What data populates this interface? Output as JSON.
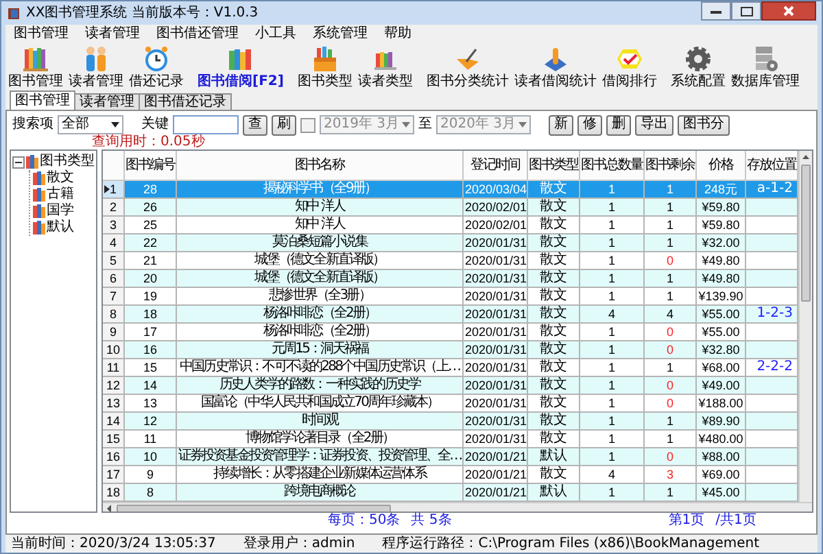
{
  "window": {
    "title": "XX图书管理系统  当前版本号：V1.0.3"
  },
  "menu": [
    "图书管理",
    "读者管理",
    "图书借还管理",
    "小工具",
    "系统管理",
    "帮助"
  ],
  "toolbar": [
    {
      "label": "图书管理",
      "emphasized": false
    },
    {
      "label": "读者管理",
      "emphasized": false
    },
    {
      "label": "借还记录",
      "emphasized": false
    },
    {
      "label": "图书借阅[F2]",
      "emphasized": true
    },
    {
      "label": "图书类型",
      "emphasized": false
    },
    {
      "label": "读者类型",
      "emphasized": false
    },
    {
      "label": "图书分类统计",
      "emphasized": false
    },
    {
      "label": "读者借阅统计",
      "emphasized": false
    },
    {
      "label": "借阅排行",
      "emphasized": false
    },
    {
      "label": "系统配置",
      "emphasized": false
    },
    {
      "label": "数据库管理",
      "emphasized": false
    }
  ],
  "tabs": [
    {
      "label": "图书管理",
      "selected": true
    },
    {
      "label": "读者管理",
      "selected": false
    },
    {
      "label": "图书借还记录",
      "selected": false
    }
  ],
  "search": {
    "field_label": "搜索项",
    "field": "全部",
    "keyword_label": "关键",
    "query_button": "查",
    "refresh_button": "刷",
    "date_filter": {
      "checked": false,
      "from": "2019年 3月",
      "to_label": "至",
      "to": "2020年 3月"
    },
    "actions": [
      "新",
      "修",
      "删",
      "导出",
      "图书分"
    ],
    "elapsed": "查询用时：0.05秒"
  },
  "tree": {
    "label": "图书类型",
    "expanded": true,
    "children": [
      {
        "label": "散文"
      },
      {
        "label": "古籍"
      },
      {
        "label": "国学"
      },
      {
        "label": "默认"
      }
    ]
  },
  "table": {
    "columns": [
      "图书编号",
      "图书名称",
      "登记时间",
      "图书类型",
      "图书总数量",
      "图书剩余",
      "价格",
      "存放位置"
    ],
    "rows": [
      {
        "index": "1",
        "id": "28",
        "name": "揭秘科学书（全9册）",
        "date": "2020/03/04",
        "type": "散文",
        "total": "1",
        "remaining": "1",
        "price": "248元",
        "location": "a-1-2",
        "selected": true,
        "low_stock": false
      },
      {
        "index": "2",
        "id": "26",
        "name": "知中 洋人",
        "date": "2020/02/01",
        "type": "散文",
        "total": "1",
        "remaining": "1",
        "price": "¥59.80",
        "selected": false,
        "low_stock": false
      },
      {
        "index": "3",
        "id": "25",
        "name": "知中 洋人",
        "date": "2020/02/01",
        "type": "散文",
        "total": "1",
        "remaining": "1",
        "price": "¥59.80",
        "selected": false,
        "low_stock": false
      },
      {
        "index": "4",
        "id": "22",
        "name": "莫泊桑短篇小说集",
        "date": "2020/01/31",
        "type": "散文",
        "total": "1",
        "remaining": "1",
        "price": "¥32.00",
        "selected": false,
        "low_stock": false
      },
      {
        "index": "5",
        "id": "21",
        "name": "城堡（德文全新直译版）",
        "date": "2020/01/31",
        "type": "散文",
        "total": "1",
        "remaining": "0",
        "price": "¥49.80",
        "selected": false,
        "low_stock": true
      },
      {
        "index": "6",
        "id": "20",
        "name": "城堡（德文全新直译版）",
        "date": "2020/01/31",
        "type": "散文",
        "total": "1",
        "remaining": "1",
        "price": "¥49.80",
        "selected": false,
        "low_stock": false
      },
      {
        "index": "7",
        "id": "19",
        "name": "悲惨世界（全3册）",
        "date": "2020/01/31",
        "type": "散文",
        "total": "1",
        "remaining": "1",
        "price": "¥139.90",
        "selected": false,
        "low_stock": false
      },
      {
        "index": "8",
        "id": "18",
        "name": "杨洛咔啡恋（全2册）",
        "date": "2020/01/31",
        "type": "散文",
        "total": "4",
        "remaining": "4",
        "price": "¥55.00",
        "location": "1-2-3",
        "selected": false,
        "low_stock": false
      },
      {
        "index": "9",
        "id": "17",
        "name": "杨洛咔啡恋（全2册）",
        "date": "2020/01/31",
        "type": "散文",
        "total": "1",
        "remaining": "0",
        "price": "¥55.00",
        "selected": false,
        "low_stock": true
      },
      {
        "index": "10",
        "id": "16",
        "name": "元周15：洞天祸福",
        "date": "2020/01/31",
        "type": "散文",
        "total": "1",
        "remaining": "0",
        "price": "¥32.80",
        "selected": false,
        "low_stock": true
      },
      {
        "index": "11",
        "id": "15",
        "name": "中国历史常识：不可不读的288个中国历史常识（上…",
        "date": "2020/01/31",
        "type": "散文",
        "total": "1",
        "remaining": "1",
        "price": "¥68.00",
        "location": "2-2-2",
        "selected": false,
        "low_stock": false
      },
      {
        "index": "12",
        "id": "14",
        "name": "历史人类学的路数：一种实践的历史学",
        "date": "2020/01/31",
        "type": "散文",
        "total": "1",
        "remaining": "0",
        "price": "¥49.00",
        "selected": false,
        "low_stock": true
      },
      {
        "index": "13",
        "id": "13",
        "name": "国富论（中华人民共和国成立70周年珍藏本）",
        "date": "2020/01/31",
        "type": "散文",
        "total": "1",
        "remaining": "0",
        "price": "¥188.00",
        "selected": false,
        "low_stock": true
      },
      {
        "index": "14",
        "id": "12",
        "name": "时间观",
        "date": "2020/01/31",
        "type": "散文",
        "total": "1",
        "remaining": "1",
        "price": "¥89.90",
        "selected": false,
        "low_stock": false
      },
      {
        "index": "15",
        "id": "11",
        "name": "博物馆学论著目录（全2册）",
        "date": "2020/01/31",
        "type": "散文",
        "total": "1",
        "remaining": "1",
        "price": "¥480.00",
        "selected": false,
        "low_stock": false
      },
      {
        "index": "16",
        "id": "10",
        "name": "证券投资基金投资管理学：证券投资、投资管理、全…",
        "date": "2020/01/21",
        "type": "默认",
        "total": "1",
        "remaining": "0",
        "price": "¥88.00",
        "selected": false,
        "low_stock": true
      },
      {
        "index": "17",
        "id": "9",
        "name": "持续增长：从零搭建企业新媒体运营体系",
        "date": "2020/01/21",
        "type": "散文",
        "total": "4",
        "remaining": "3",
        "price": "¥69.00",
        "selected": false,
        "low_stock": true
      },
      {
        "index": "18",
        "id": "8",
        "name": "跨境电商概论",
        "date": "2020/01/21",
        "type": "默认",
        "total": "1",
        "remaining": "1",
        "price": "¥45.00",
        "selected": false,
        "low_stock": false
      }
    ]
  },
  "paging": {
    "page_size": "每页：50条",
    "count": "共 5条",
    "page": "第1页",
    "pages": "/共1页"
  },
  "status_bar": {
    "time": "当前时间：2020/3/24 13:05:37",
    "user": "登录用户：admin",
    "path": "程序运行路径：C:\\Program Files (x86)\\BookManagement"
  }
}
